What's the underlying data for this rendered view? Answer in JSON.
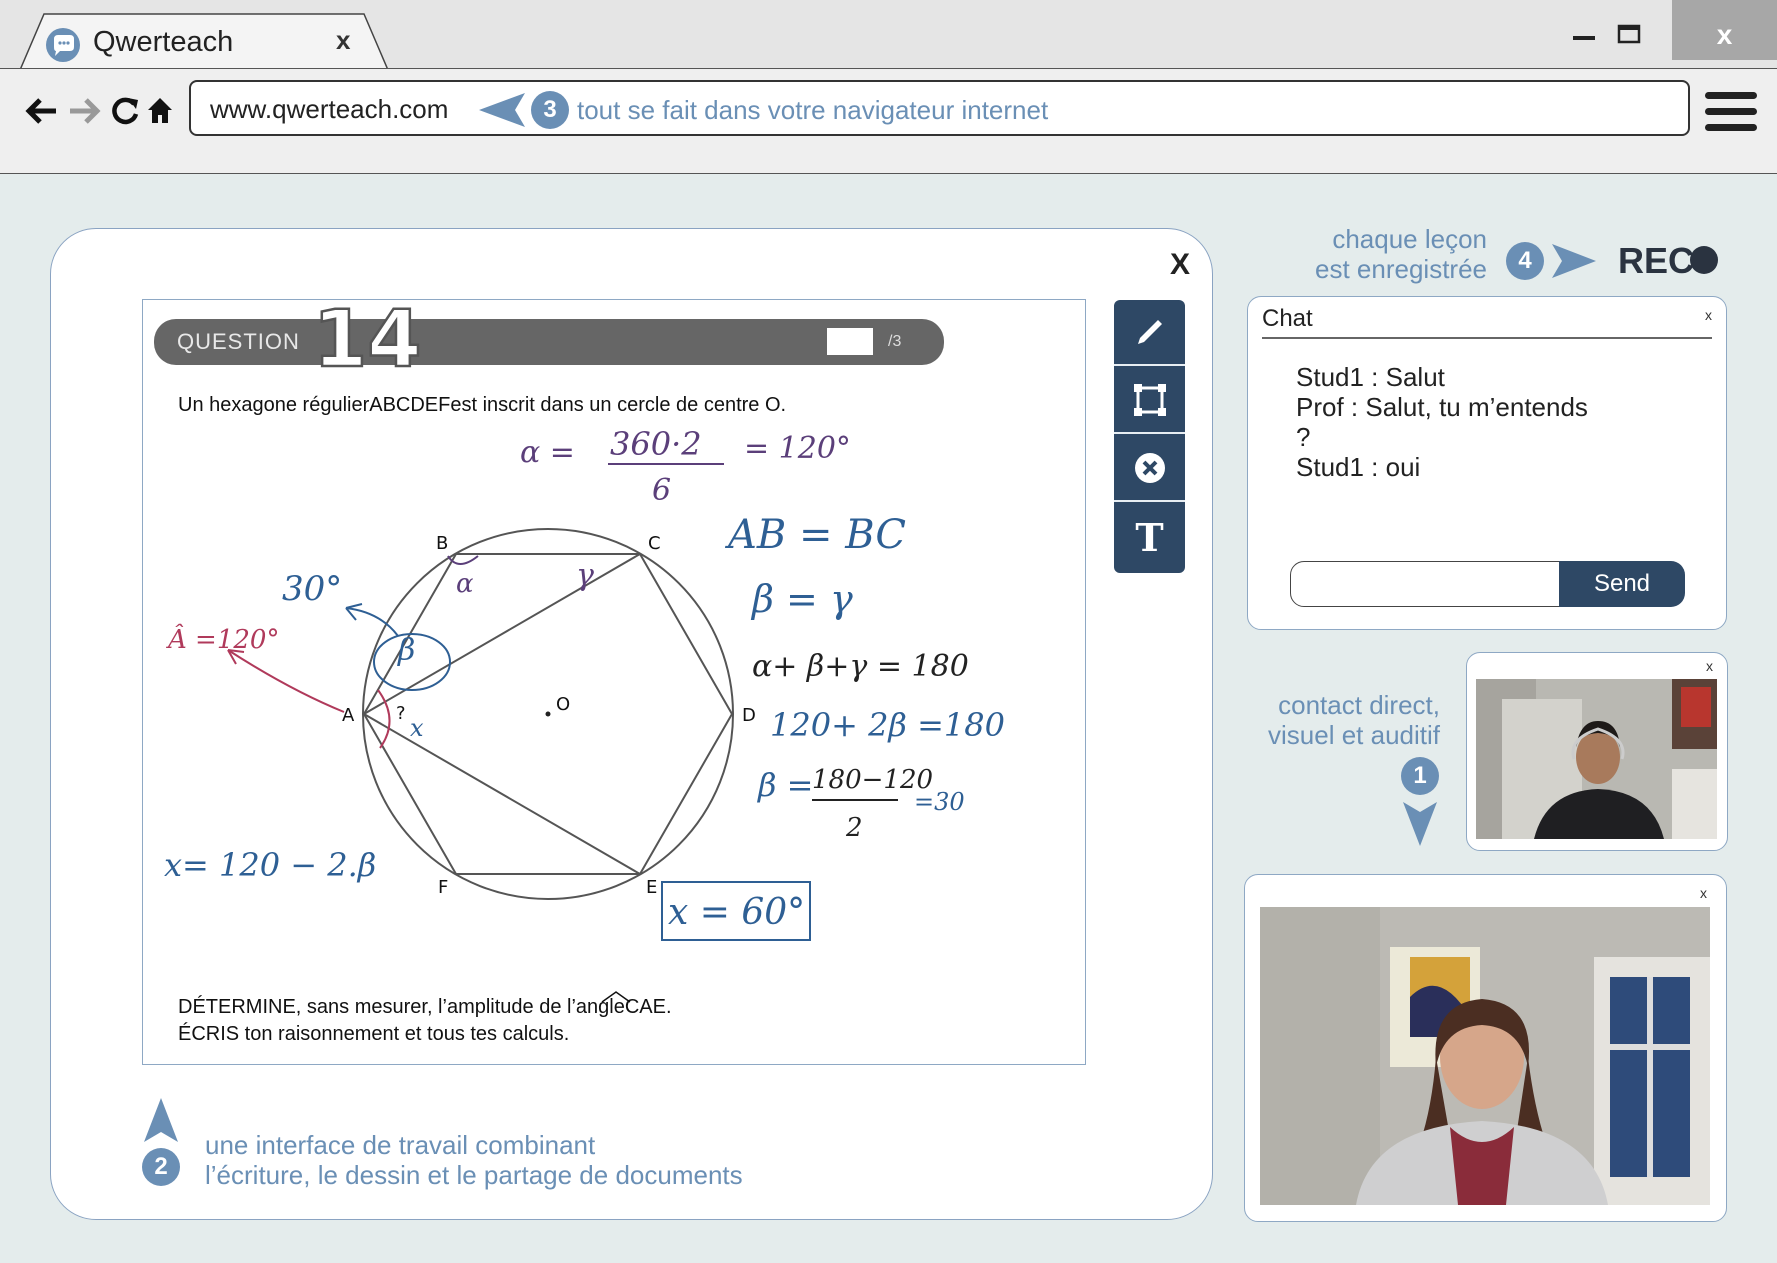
{
  "browser": {
    "tab_title": "Qwerteach",
    "tab_close": "x",
    "window_close": "x",
    "url": "www.qwerteach.com"
  },
  "annotations": {
    "browser_hint": {
      "number": "3",
      "text": "tout se fait dans votre navigateur internet"
    },
    "recording_hint": {
      "line1": "chaque leçon",
      "line2": "est enregistrée",
      "number": "4"
    },
    "contact_hint": {
      "line1": "contact direct,",
      "line2": "visuel et auditif",
      "number": "1"
    },
    "workspace_hint": {
      "line1": "une interface de travail combinant",
      "line2": "l’écriture, le dessin et le partage de documents",
      "number": "2"
    }
  },
  "recording": {
    "label": "REC"
  },
  "workspace": {
    "close": "X"
  },
  "document": {
    "question_label": "QUESTION",
    "question_number": "14",
    "score_total": "/3",
    "problem_text": "Un hexagone régulierABCDEFest inscrit dans un cercle de centre O.",
    "instruction_1": "DÉTERMINE, sans mesurer, l’amplitude de l’angleCAE.",
    "instruction_2": "ÉCRIS ton raisonnement et tous tes calculs.",
    "vertex_labels": {
      "A": "A",
      "B": "B",
      "C": "C",
      "D": "D",
      "E": "E",
      "F": "F",
      "O": "O"
    }
  },
  "handwriting": {
    "alpha_eq": "α = 360·2 / 6 = 120°",
    "alpha_num": "360·2",
    "alpha_den": "6",
    "alpha_res": "= 120°",
    "arcs": "AB = BC",
    "beta_gamma": "β = γ",
    "sum": "α+ β+γ = 180",
    "eq2": "120+ 2β =180",
    "beta_num": "180−120",
    "beta_den": "2",
    "beta_res": "=30",
    "beta_lhs": "β =",
    "thirty": "30°",
    "angle_a": "Â =120°",
    "x_eq": "x= 120 − 2.β",
    "x_result": "x = 60°",
    "q": "?",
    "x_label": "x",
    "alpha_mark": "α",
    "gamma_mark": "γ",
    "beta_mark": "β"
  },
  "tools": [
    "pen-tool",
    "select-tool",
    "erase-tool",
    "text-tool"
  ],
  "tool_text_glyph": "T",
  "chat": {
    "title": "Chat",
    "close": "x",
    "messages": [
      "Stud1 : Salut",
      "Prof : Salut, tu m’entends",
      "?",
      "Stud1 : oui"
    ],
    "input_value": "",
    "send_label": "Send"
  },
  "video": {
    "small_close": "x",
    "large_close": "x"
  },
  "colors": {
    "accent": "#6a8fb5",
    "navy": "#2e4865",
    "ink_purple": "#5b3f7a",
    "ink_blue": "#2e5f94",
    "ink_red": "#b03a5b"
  }
}
